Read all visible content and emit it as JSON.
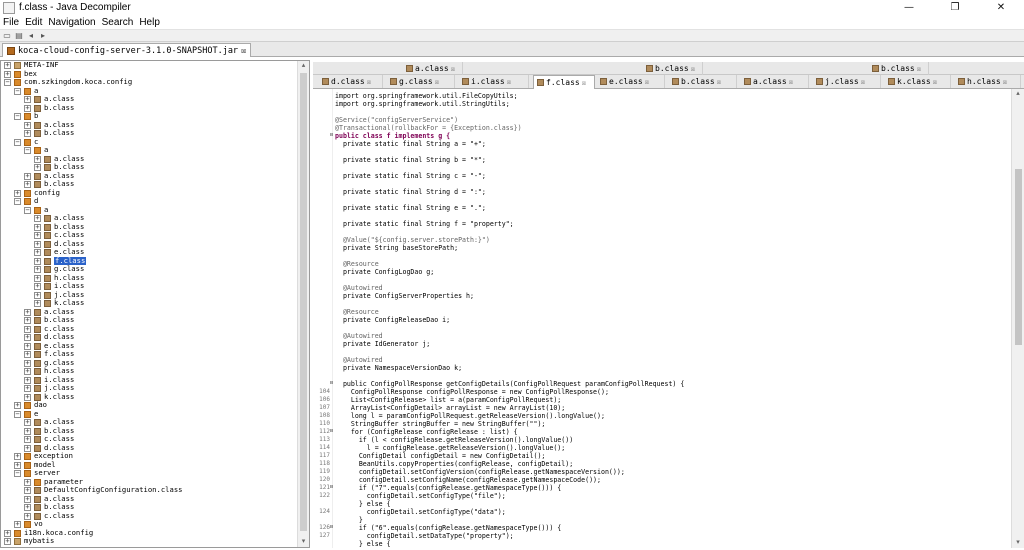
{
  "window": {
    "title": "f.class - Java Decompiler",
    "minimize": "—",
    "maximize": "❐",
    "close": "✕"
  },
  "menu": [
    "File",
    "Edit",
    "Navigation",
    "Search",
    "Help"
  ],
  "jar_tab": {
    "label": "koca-cloud-config-server-3.1.0-SNAPSHOT.jar",
    "close": "☒"
  },
  "tree": [
    {
      "label": "META-INF",
      "lvl": 0,
      "exp": "+",
      "kind": "fld"
    },
    {
      "label": "bex",
      "lvl": 0,
      "exp": "+",
      "kind": "pkg"
    },
    {
      "label": "com.szkingdom.koca.config",
      "lvl": 0,
      "exp": "-",
      "kind": "pkg"
    },
    {
      "label": "a",
      "lvl": 1,
      "exp": "-",
      "kind": "pkg"
    },
    {
      "label": "a.class",
      "lvl": 2,
      "exp": "+",
      "kind": "cls"
    },
    {
      "label": "b.class",
      "lvl": 2,
      "exp": "+",
      "kind": "cls"
    },
    {
      "label": "b",
      "lvl": 1,
      "exp": "-",
      "kind": "pkg"
    },
    {
      "label": "a.class",
      "lvl": 2,
      "exp": "+",
      "kind": "cls"
    },
    {
      "label": "b.class",
      "lvl": 2,
      "exp": "+",
      "kind": "cls"
    },
    {
      "label": "c",
      "lvl": 1,
      "exp": "-",
      "kind": "pkg"
    },
    {
      "label": "a",
      "lvl": 2,
      "exp": "-",
      "kind": "pkg"
    },
    {
      "label": "a.class",
      "lvl": 3,
      "exp": "+",
      "kind": "cls"
    },
    {
      "label": "b.class",
      "lvl": 3,
      "exp": "+",
      "kind": "cls"
    },
    {
      "label": "a.class",
      "lvl": 2,
      "exp": "+",
      "kind": "cls"
    },
    {
      "label": "b.class",
      "lvl": 2,
      "exp": "+",
      "kind": "cls"
    },
    {
      "label": "config",
      "lvl": 1,
      "exp": "+",
      "kind": "pkg"
    },
    {
      "label": "d",
      "lvl": 1,
      "exp": "-",
      "kind": "pkg"
    },
    {
      "label": "a",
      "lvl": 2,
      "exp": "-",
      "kind": "pkg"
    },
    {
      "label": "a.class",
      "lvl": 3,
      "exp": "+",
      "kind": "cls"
    },
    {
      "label": "b.class",
      "lvl": 3,
      "exp": "+",
      "kind": "cls"
    },
    {
      "label": "c.class",
      "lvl": 3,
      "exp": "+",
      "kind": "cls"
    },
    {
      "label": "d.class",
      "lvl": 3,
      "exp": "+",
      "kind": "cls"
    },
    {
      "label": "e.class",
      "lvl": 3,
      "exp": "+",
      "kind": "cls"
    },
    {
      "label": "f.class",
      "lvl": 3,
      "exp": "+",
      "kind": "cls",
      "selected": true
    },
    {
      "label": "g.class",
      "lvl": 3,
      "exp": "+",
      "kind": "cls"
    },
    {
      "label": "h.class",
      "lvl": 3,
      "exp": "+",
      "kind": "cls"
    },
    {
      "label": "i.class",
      "lvl": 3,
      "exp": "+",
      "kind": "cls"
    },
    {
      "label": "j.class",
      "lvl": 3,
      "exp": "+",
      "kind": "cls"
    },
    {
      "label": "k.class",
      "lvl": 3,
      "exp": "+",
      "kind": "cls"
    },
    {
      "label": "a.class",
      "lvl": 2,
      "exp": "+",
      "kind": "cls"
    },
    {
      "label": "b.class",
      "lvl": 2,
      "exp": "+",
      "kind": "cls"
    },
    {
      "label": "c.class",
      "lvl": 2,
      "exp": "+",
      "kind": "cls"
    },
    {
      "label": "d.class",
      "lvl": 2,
      "exp": "+",
      "kind": "cls"
    },
    {
      "label": "e.class",
      "lvl": 2,
      "exp": "+",
      "kind": "cls"
    },
    {
      "label": "f.class",
      "lvl": 2,
      "exp": "+",
      "kind": "cls"
    },
    {
      "label": "g.class",
      "lvl": 2,
      "exp": "+",
      "kind": "cls"
    },
    {
      "label": "h.class",
      "lvl": 2,
      "exp": "+",
      "kind": "cls"
    },
    {
      "label": "i.class",
      "lvl": 2,
      "exp": "+",
      "kind": "cls"
    },
    {
      "label": "j.class",
      "lvl": 2,
      "exp": "+",
      "kind": "cls"
    },
    {
      "label": "k.class",
      "lvl": 2,
      "exp": "+",
      "kind": "cls"
    },
    {
      "label": "dao",
      "lvl": 1,
      "exp": "+",
      "kind": "pkg"
    },
    {
      "label": "e",
      "lvl": 1,
      "exp": "-",
      "kind": "pkg"
    },
    {
      "label": "a.class",
      "lvl": 2,
      "exp": "+",
      "kind": "cls"
    },
    {
      "label": "b.class",
      "lvl": 2,
      "exp": "+",
      "kind": "cls"
    },
    {
      "label": "c.class",
      "lvl": 2,
      "exp": "+",
      "kind": "cls"
    },
    {
      "label": "d.class",
      "lvl": 2,
      "exp": "+",
      "kind": "cls"
    },
    {
      "label": "exception",
      "lvl": 1,
      "exp": "+",
      "kind": "pkg"
    },
    {
      "label": "model",
      "lvl": 1,
      "exp": "+",
      "kind": "pkg"
    },
    {
      "label": "server",
      "lvl": 1,
      "exp": "-",
      "kind": "pkg"
    },
    {
      "label": "parameter",
      "lvl": 2,
      "exp": "+",
      "kind": "pkg"
    },
    {
      "label": "DefaultConfigConfiguration.class",
      "lvl": 2,
      "exp": "+",
      "kind": "cls"
    },
    {
      "label": "a.class",
      "lvl": 2,
      "exp": "+",
      "kind": "cls"
    },
    {
      "label": "b.class",
      "lvl": 2,
      "exp": "+",
      "kind": "cls"
    },
    {
      "label": "c.class",
      "lvl": 2,
      "exp": "+",
      "kind": "cls"
    },
    {
      "label": "vo",
      "lvl": 1,
      "exp": "+",
      "kind": "pkg"
    },
    {
      "label": "i18n.koca.config",
      "lvl": 0,
      "exp": "+",
      "kind": "pkg"
    },
    {
      "label": "mybatis",
      "lvl": 0,
      "exp": "+",
      "kind": "fld"
    }
  ],
  "editor_tabs_row1": [
    {
      "label": "a.class"
    },
    {
      "label": "b.class"
    },
    {
      "label": "b.class"
    }
  ],
  "editor_tabs_row2": [
    {
      "label": "d.class"
    },
    {
      "label": "g.class"
    },
    {
      "label": "i.class"
    },
    {
      "label": "f.class",
      "active": true
    },
    {
      "label": "e.class"
    },
    {
      "label": "b.class"
    },
    {
      "label": "a.class"
    },
    {
      "label": "j.class"
    },
    {
      "label": "k.class"
    },
    {
      "label": "h.class"
    }
  ],
  "code": [
    {
      "ln": "",
      "t": "import org.springframework.util.FileCopyUtils;"
    },
    {
      "ln": "",
      "t": "import org.springframework.util.StringUtils;"
    },
    {
      "ln": "",
      "t": ""
    },
    {
      "ln": "",
      "t": "@Service(\"configServerService\")",
      "c": "ann"
    },
    {
      "ln": "",
      "t": "@Transactional(rollbackFor = {Exception.class})",
      "c": "ann"
    },
    {
      "ln": "",
      "t": "public class f implements g {",
      "c": "kw",
      "fold": "-"
    },
    {
      "ln": "",
      "t": "  private static final String a = \"+\";"
    },
    {
      "ln": "",
      "t": ""
    },
    {
      "ln": "",
      "t": "  private static final String b = \"*\";"
    },
    {
      "ln": "",
      "t": ""
    },
    {
      "ln": "",
      "t": "  private static final String c = \"-\";"
    },
    {
      "ln": "",
      "t": ""
    },
    {
      "ln": "",
      "t": "  private static final String d = \":\";"
    },
    {
      "ln": "",
      "t": ""
    },
    {
      "ln": "",
      "t": "  private static final String e = \".\";"
    },
    {
      "ln": "",
      "t": ""
    },
    {
      "ln": "",
      "t": "  private static final String f = \"property\";"
    },
    {
      "ln": "",
      "t": ""
    },
    {
      "ln": "",
      "t": "  @Value(\"${config.server.storePath:}\")",
      "c": "ann"
    },
    {
      "ln": "",
      "t": "  private String baseStorePath;"
    },
    {
      "ln": "",
      "t": ""
    },
    {
      "ln": "",
      "t": "  @Resource",
      "c": "ann"
    },
    {
      "ln": "",
      "t": "  private ConfigLogDao g;"
    },
    {
      "ln": "",
      "t": ""
    },
    {
      "ln": "",
      "t": "  @Autowired",
      "c": "ann"
    },
    {
      "ln": "",
      "t": "  private ConfigServerProperties h;"
    },
    {
      "ln": "",
      "t": ""
    },
    {
      "ln": "",
      "t": "  @Resource",
      "c": "ann"
    },
    {
      "ln": "",
      "t": "  private ConfigReleaseDao i;"
    },
    {
      "ln": "",
      "t": ""
    },
    {
      "ln": "",
      "t": "  @Autowired",
      "c": "ann"
    },
    {
      "ln": "",
      "t": "  private IdGenerator j;"
    },
    {
      "ln": "",
      "t": ""
    },
    {
      "ln": "",
      "t": "  @Autowired",
      "c": "ann"
    },
    {
      "ln": "",
      "t": "  private NamespaceVersionDao k;"
    },
    {
      "ln": "",
      "t": ""
    },
    {
      "ln": "",
      "t": "  public ConfigPollResponse getConfigDetails(ConfigPollRequest paramConfigPollRequest) {",
      "fold": "-"
    },
    {
      "ln": "104",
      "t": "    ConfigPollResponse configPollResponse = new ConfigPollResponse();"
    },
    {
      "ln": "106",
      "t": "    List<ConfigRelease> list = a(paramConfigPollRequest);"
    },
    {
      "ln": "107",
      "t": "    ArrayList<ConfigDetail> arrayList = new ArrayList(10);"
    },
    {
      "ln": "108",
      "t": "    long l = paramConfigPollRequest.getReleaseVersion().longValue();"
    },
    {
      "ln": "110",
      "t": "    StringBuffer stringBuffer = new StringBuffer(\"\");"
    },
    {
      "ln": "112",
      "t": "    for (ConfigRelease configRelease : list) {",
      "fold": "-"
    },
    {
      "ln": "113",
      "t": "      if (l < configRelease.getReleaseVersion().longValue())"
    },
    {
      "ln": "114",
      "t": "        l = configRelease.getReleaseVersion().longValue();"
    },
    {
      "ln": "117",
      "t": "      ConfigDetail configDetail = new ConfigDetail();"
    },
    {
      "ln": "118",
      "t": "      BeanUtils.copyProperties(configRelease, configDetail);"
    },
    {
      "ln": "119",
      "t": "      configDetail.setConfigVersion(configRelease.getNamespaceVersion());"
    },
    {
      "ln": "120",
      "t": "      configDetail.setConfigName(configRelease.getNamespaceCode());"
    },
    {
      "ln": "121",
      "t": "      if (\"7\".equals(configRelease.getNamespaceType())) {",
      "fold": "-"
    },
    {
      "ln": "122",
      "t": "        configDetail.setConfigType(\"file\");"
    },
    {
      "ln": "",
      "t": "      } else {"
    },
    {
      "ln": "124",
      "t": "        configDetail.setConfigType(\"data\");"
    },
    {
      "ln": "",
      "t": "      }"
    },
    {
      "ln": "126",
      "t": "      if (\"6\".equals(configRelease.getNamespaceType())) {",
      "fold": "-"
    },
    {
      "ln": "127",
      "t": "        configDetail.setDataType(\"property\");"
    },
    {
      "ln": "",
      "t": "      } else {"
    }
  ]
}
